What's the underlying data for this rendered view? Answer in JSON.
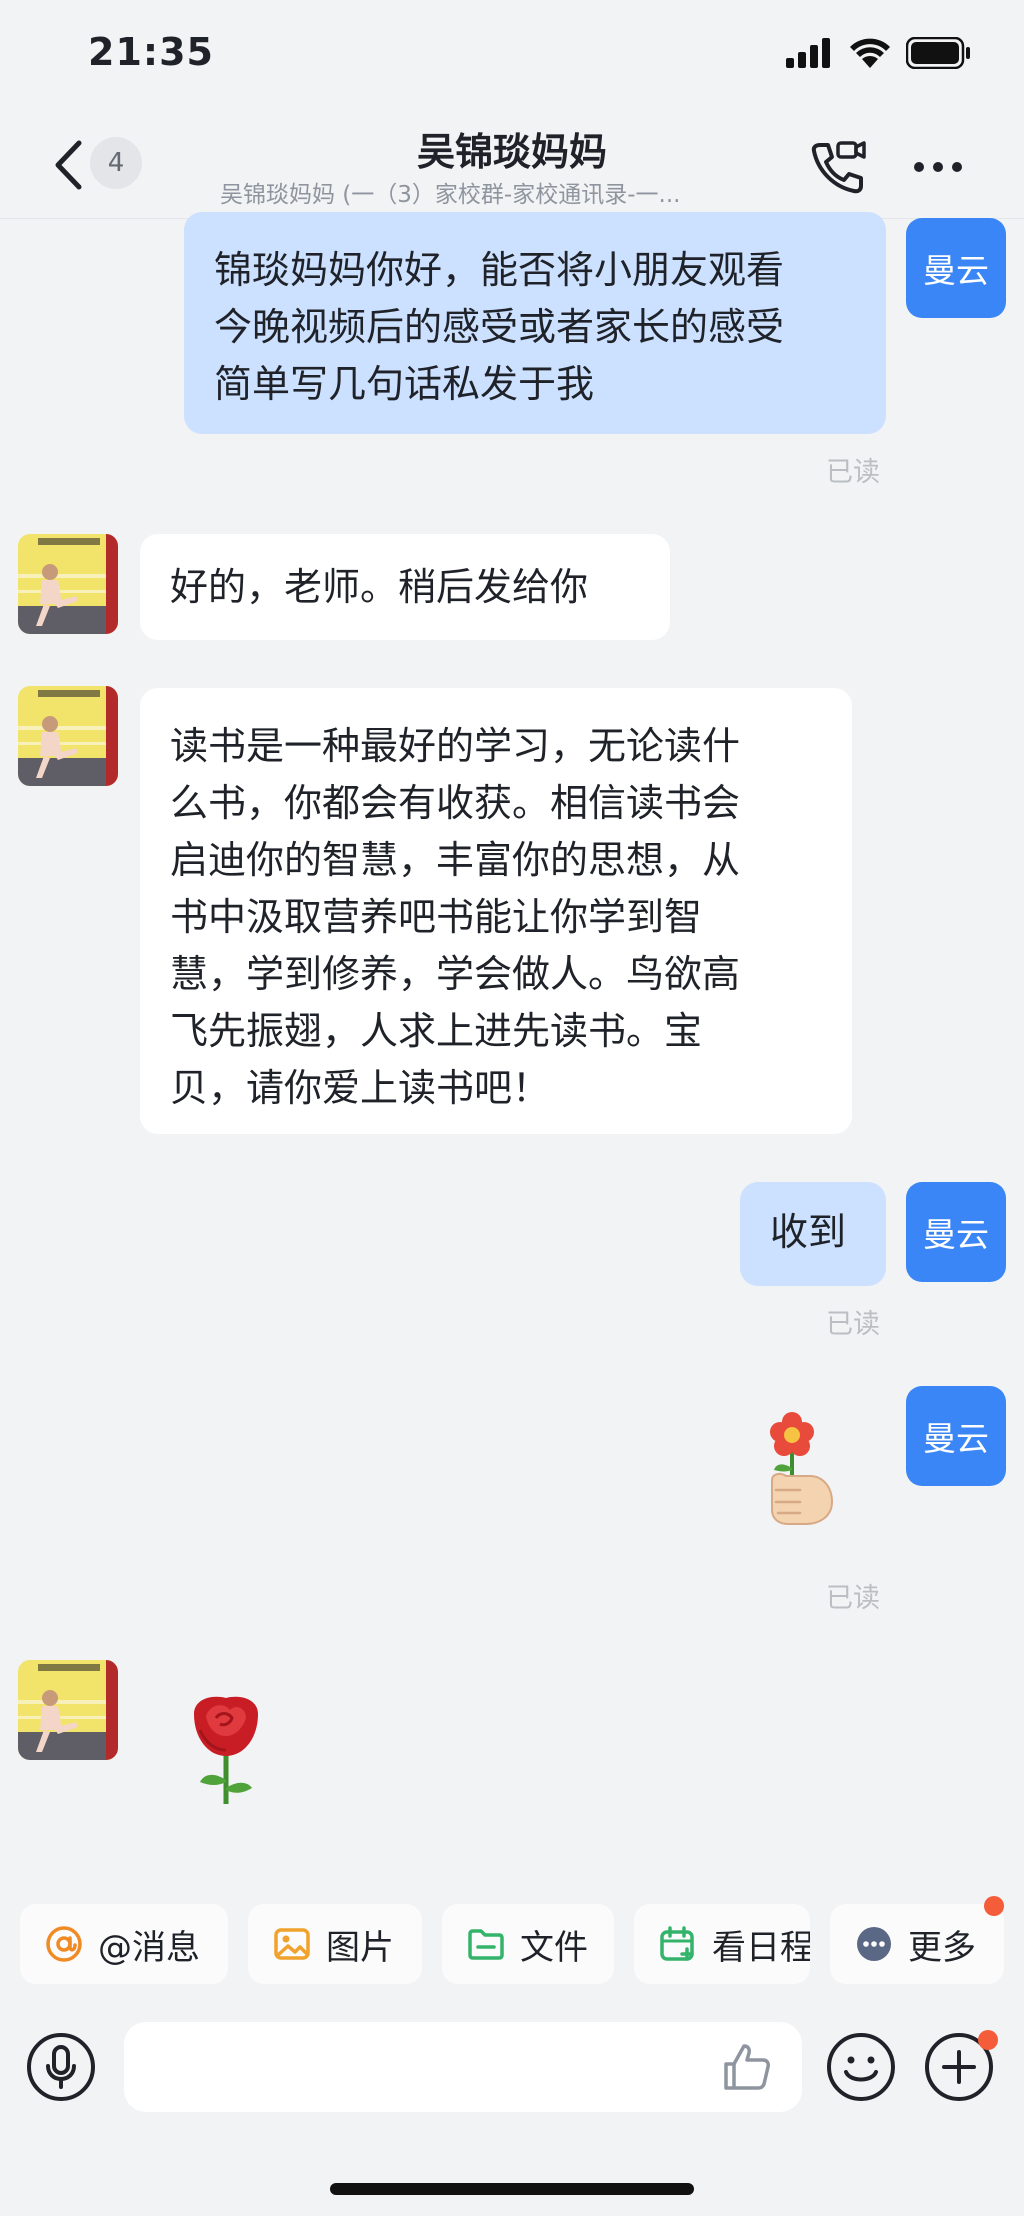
{
  "status_bar": {
    "time": "21:35"
  },
  "header": {
    "unread_count": "4",
    "title": "吴锦琰妈妈",
    "subtitle": "吴锦琰妈妈 (一（3）家校群-家校通讯录-一..."
  },
  "me": {
    "avatar_label": "曼云"
  },
  "messages": [
    {
      "direction": "out",
      "text_lines": [
        "锦琰妈妈你好，能否将小朋友观看",
        "今晚视频后的感受或者家长的感受",
        "简单写几句话私发于我"
      ],
      "status": "已读"
    },
    {
      "direction": "in",
      "text_lines": [
        "好的，老师。稍后发给你"
      ]
    },
    {
      "direction": "in",
      "text_lines": [
        "读书是一种最好的学习，无论读什",
        "么书，你都会有收获。相信读书会",
        "启迪你的智慧，丰富你的思想，从",
        "书中汲取营养吧书能让你学到智",
        "慧，学到修养，学会做人。鸟欲高",
        "飞先振翅，人求上进先读书。宝",
        "贝，请你爱上读书吧！"
      ]
    },
    {
      "direction": "out",
      "text_lines": [
        "收到"
      ],
      "status": "已读"
    },
    {
      "direction": "out",
      "sticker": "hand-holding-flower",
      "status": "已读"
    },
    {
      "direction": "in",
      "sticker": "rose"
    }
  ],
  "quick_actions": [
    {
      "label": "@消息",
      "icon": "at-icon"
    },
    {
      "label": "图片",
      "icon": "image-icon"
    },
    {
      "label": "文件",
      "icon": "folder-icon"
    },
    {
      "label": "看日程",
      "icon": "calendar-icon"
    },
    {
      "label": "更多",
      "icon": "more-icon"
    }
  ],
  "input": {
    "placeholder": "",
    "value": ""
  },
  "colors": {
    "background": "#f2f3f5",
    "out_bubble": "#cce0ff",
    "in_bubble": "#ffffff",
    "my_avatar": "#3b86f6",
    "read_status": "#bbbfc4",
    "red_dot": "#f55c3a"
  }
}
